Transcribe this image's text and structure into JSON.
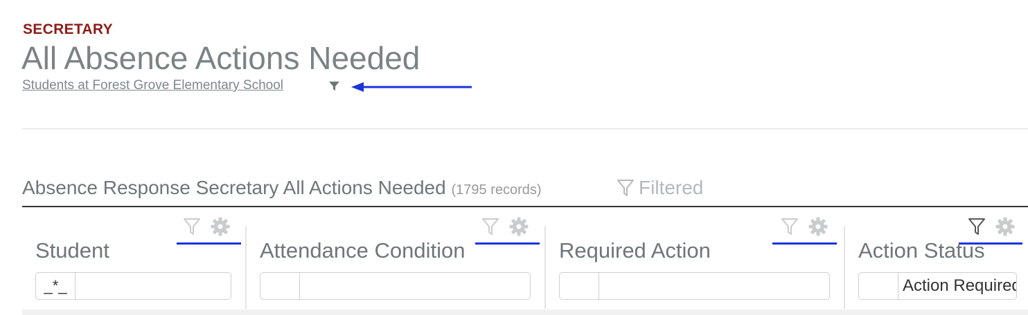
{
  "header": {
    "role": "SECRETARY",
    "title": "All Absence Actions Needed",
    "scope_link": "Students at Forest Grove Elementary School"
  },
  "grid": {
    "title": "Absence Response Secretary All Actions Needed",
    "record_count": "(1795 records)",
    "filtered_label": "Filtered",
    "columns": [
      {
        "label": "Student",
        "filter_operator": "_*_",
        "filter_value": "",
        "filter_active": false
      },
      {
        "label": "Attendance Condition",
        "filter_operator": "",
        "filter_value": "",
        "filter_active": false
      },
      {
        "label": "Required Action",
        "filter_operator": "",
        "filter_value": "",
        "filter_active": false
      },
      {
        "label": "Action Status",
        "filter_operator": "",
        "filter_value": "Action Required",
        "filter_active": true
      }
    ]
  },
  "colors": {
    "role": "#8c1d18",
    "annotation_blue": "#1b33d9",
    "muted_icon": "#c8cccd",
    "active_icon": "#555555"
  },
  "icons": {
    "scope_filter": "funnel-icon",
    "column_filter": "funnel-outline-icon",
    "column_settings": "gear-icon"
  }
}
